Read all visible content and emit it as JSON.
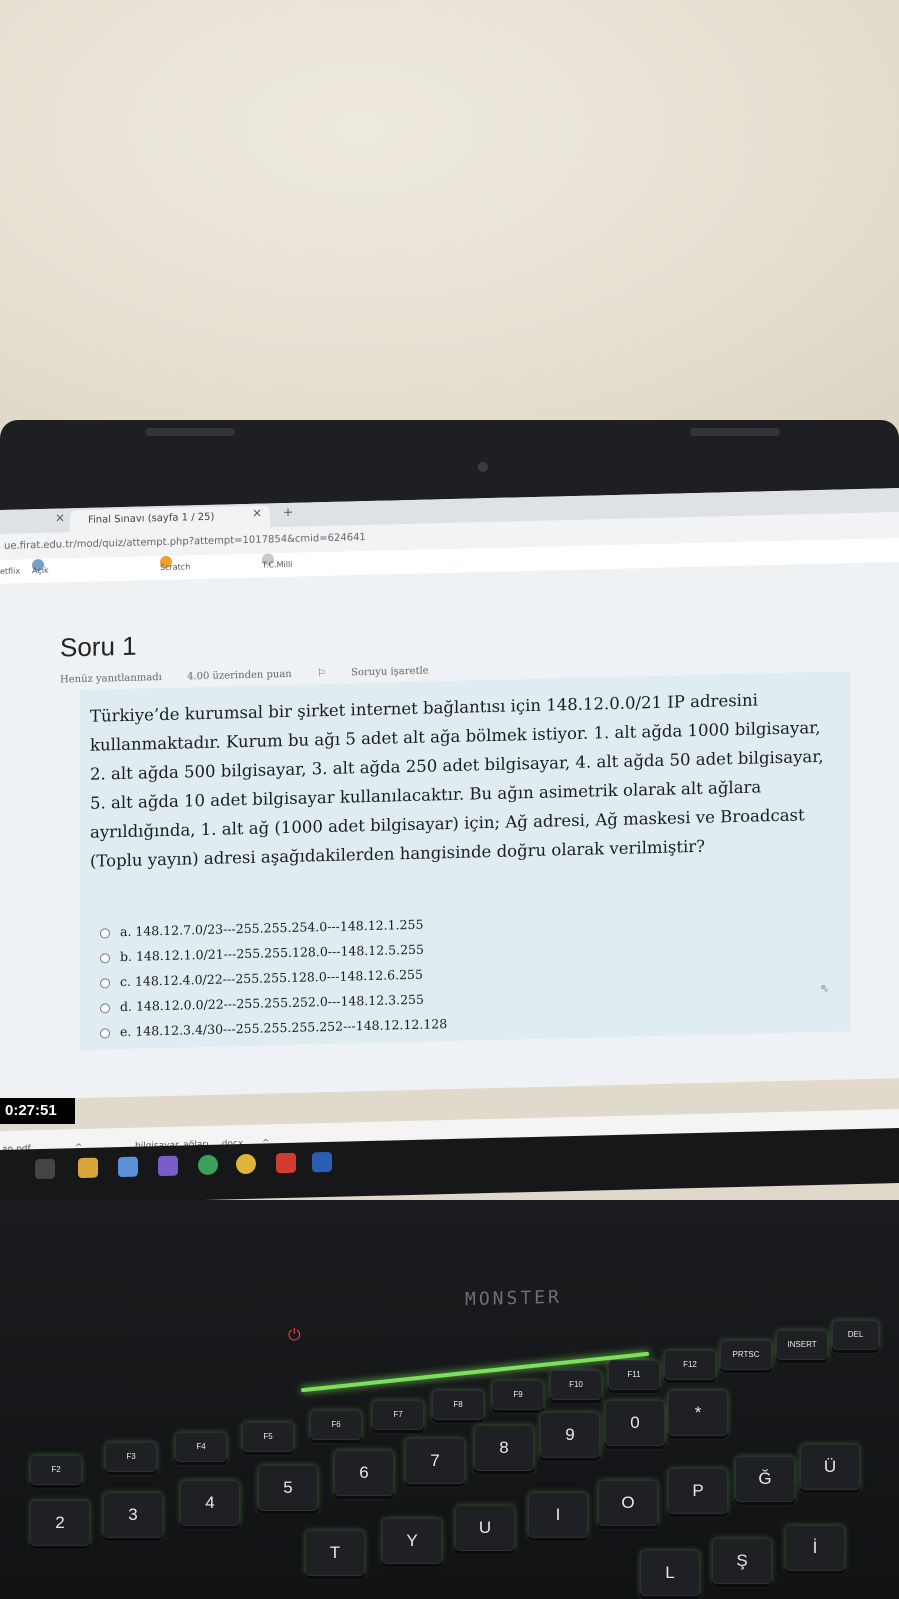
{
  "browser": {
    "tab_title": "Final Sınavı (sayfa 1 / 25)",
    "tab_close": "×",
    "new_tab": "+",
    "url": "ue.firat.edu.tr/mod/quiz/attempt.php?attempt=1017854&cmid=624641",
    "bookmarks": [
      "etflix",
      "Açık kaynak kodlu i...",
      "Scratch Dersleri",
      "T.C.Milli Eğitim Bak..."
    ]
  },
  "quiz": {
    "title": "Soru 1",
    "status": "Henüz yanıtlanmadı",
    "points": "4.00 üzerinden puan",
    "flag": "Soruyu işaretle",
    "question": "Türkiye’de kurumsal bir şirket internet bağlantısı için 148.12.0.0/21 IP adresini kullanmaktadır. Kurum bu ağı 5 adet alt ağa bölmek istiyor. 1. alt ağda 1000 bilgisayar, 2. alt ağda 500 bilgisayar, 3. alt ağda 250 adet bilgisayar, 4. alt ağda 50 adet bilgisayar, 5. alt ağda 10 adet bilgisayar kullanılacaktır. Bu ağın asimetrik olarak alt ağlara ayrıldığında, 1. alt ağ (1000 adet bilgisayar) için; Ağ adresi, Ağ maskesi ve Broadcast (Toplu yayın) adresi aşağıdakilerden hangisinde doğru olarak verilmiştir?",
    "answers": [
      "a. 148.12.7.0/23---255.255.254.0---148.12.1.255",
      "b. 148.12.1.0/21---255.255.128.0---148.12.5.255",
      "c. 148.12.4.0/22---255.255.128.0---148.12.6.255",
      "d. 148.12.0.0/22---255.255.252.0---148.12.3.255",
      "e. 148.12.3.4/30---255.255.255.252---148.12.12.128"
    ]
  },
  "timer": "0:27:51",
  "downloads": [
    "an.pdf",
    "bilgisayar_ağları_...docx"
  ],
  "laptop": {
    "brand": "MONSTER",
    "fkeys": [
      "F2",
      "F3",
      "F4",
      "F5",
      "F6",
      "F7",
      "F8",
      "F9",
      "F10",
      "F11",
      "F12",
      "PRTSC",
      "INSERT",
      "DEL"
    ],
    "keys_row1": [
      "2",
      "3",
      "4",
      "5",
      "6",
      "7",
      "8",
      "9",
      "0",
      "*"
    ],
    "keys_row2": [
      "T",
      "Y",
      "U",
      "I",
      "O",
      "P",
      "Ğ",
      "Ü"
    ],
    "keys_row3": [
      "L",
      "Ş",
      "İ"
    ]
  }
}
